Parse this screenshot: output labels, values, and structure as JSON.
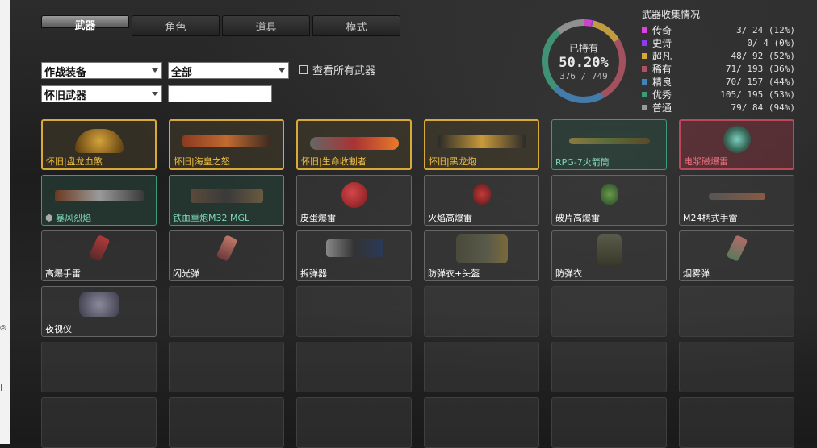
{
  "tabs": [
    {
      "label": "武器",
      "active": true
    },
    {
      "label": "角色",
      "active": false
    },
    {
      "label": "道具",
      "active": false
    },
    {
      "label": "模式",
      "active": false
    }
  ],
  "filters": {
    "select1": "作战装备",
    "select2": "全部",
    "select3": "怀旧武器",
    "search_value": "",
    "show_all_label": "查看所有武器",
    "show_all_checked": false
  },
  "summary": {
    "title": "武器收集情况",
    "owned_label": "已持有",
    "percent": "50.20%",
    "fraction": "376 / 749",
    "rows": [
      {
        "name": "传奇",
        "value": "3/  24  (12%)",
        "color": "#e040e0"
      },
      {
        "name": "史诗",
        "value": "0/   4   (0%)",
        "color": "#8a3cf0"
      },
      {
        "name": "超凡",
        "value": "48/  92  (52%)",
        "color": "#d4a83a"
      },
      {
        "name": "稀有",
        "value": "71/ 193  (36%)",
        "color": "#b05060"
      },
      {
        "name": "精良",
        "value": "70/ 157  (44%)",
        "color": "#3f83b8"
      },
      {
        "name": "优秀",
        "value": "105/ 195  (53%)",
        "color": "#3c9c7a"
      },
      {
        "name": "普通",
        "value": "79/  84  (94%)",
        "color": "#9a9a9a"
      }
    ]
  },
  "items": [
    {
      "label": "怀旧|盘龙血煞",
      "rarity": "legend",
      "icon": "dragon-weapon-icon"
    },
    {
      "label": "怀旧|海皇之怒",
      "rarity": "legend",
      "icon": "launcher-icon"
    },
    {
      "label": "怀旧|生命收割者",
      "rarity": "legend",
      "icon": "chainsaw-icon"
    },
    {
      "label": "怀旧|黑龙炮",
      "rarity": "legend",
      "icon": "black-dragon-cannon-icon"
    },
    {
      "label": "RPG-7火箭筒",
      "rarity": "excellent",
      "icon": "rpg-icon"
    },
    {
      "label": "电浆磁爆雷",
      "rarity": "rare",
      "icon": "plasma-mine-icon"
    },
    {
      "label": "暴风烈焰",
      "rarity": "excellent",
      "icon": "flamethrower-icon",
      "badge": true
    },
    {
      "label": "铁血重炮M32 MGL",
      "rarity": "excellent",
      "icon": "grenade-launcher-icon"
    },
    {
      "label": "皮蛋爆雷",
      "rarity": "normal",
      "icon": "egg-bomb-icon"
    },
    {
      "label": "火焰高爆雷",
      "rarity": "normal",
      "icon": "fire-grenade-icon"
    },
    {
      "label": "破片高爆雷",
      "rarity": "normal",
      "icon": "frag-grenade-icon"
    },
    {
      "label": "M24柄式手雷",
      "rarity": "normal",
      "icon": "stick-grenade-icon"
    },
    {
      "label": "高爆手雷",
      "rarity": "normal",
      "icon": "he-grenade-icon"
    },
    {
      "label": "闪光弹",
      "rarity": "normal",
      "icon": "flashbang-icon"
    },
    {
      "label": "拆弹器",
      "rarity": "normal",
      "icon": "defuse-kit-icon"
    },
    {
      "label": "防弹衣+头盔",
      "rarity": "normal",
      "icon": "vest-helmet-icon"
    },
    {
      "label": "防弹衣",
      "rarity": "normal",
      "icon": "vest-icon"
    },
    {
      "label": "烟雾弹",
      "rarity": "normal",
      "icon": "smoke-grenade-icon"
    },
    {
      "label": "夜视仪",
      "rarity": "normal",
      "icon": "night-vision-icon"
    }
  ],
  "empty_slots": 17
}
